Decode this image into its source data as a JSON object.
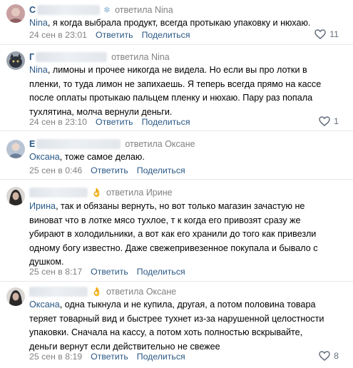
{
  "comments": [
    {
      "author_initial": "С",
      "badge": "❄",
      "replied_to": "ответила Nina",
      "mention": "Nina",
      "lines": [
        ", я когда выбрала продукт, всегда протыкаю упаковку и нюхаю."
      ],
      "time": "24 сен в 23:01",
      "reply_label": "Ответить",
      "share_label": "Поделиться",
      "likes": "11",
      "avatar_color": "#b98b8c"
    },
    {
      "author_initial": "Г",
      "replied_to": "ответила Nina",
      "mention": "Nina",
      "lines": [
        ", лимоны и прочее никогда не видела. Но если вы про лотки в",
        "пленки, то туда лимон не запихаешь. Я теперь всегда прямо на кассе",
        "после оплаты протыкаю пальцем пленку и нюхаю. Пару раз попала",
        "тухлятина, молча вернули деньги."
      ],
      "time": "24 сен в 23:10",
      "reply_label": "Ответить",
      "share_label": "Поделиться",
      "likes": "1",
      "avatar_color": "#3c4350"
    },
    {
      "author_initial": "Е",
      "replied_to": "ответила Оксане",
      "mention": "Оксана",
      "lines": [
        ", тоже самое делаю."
      ],
      "time": "25 сен в 0:46",
      "reply_label": "Ответить",
      "share_label": "Поделиться",
      "avatar_color": "#8a9bb2"
    },
    {
      "badge": "👌",
      "replied_to": "ответила Ирине",
      "mention": "Ирина",
      "lines": [
        ", так и обязаны вернуть, но вот только магазин зачастую не",
        "виноват что в лотке мясо тухлое, т к когда его привозят сразу же",
        "убирают в холодильники, а вот как его хранили до того как привезли",
        "одному богу известно. Даже свежепривезенное покупала и бывало с",
        "душком."
      ],
      "time": "25 сен в 8:17",
      "reply_label": "Ответить",
      "share_label": "Поделиться",
      "avatar_color": "#2d2b2b"
    },
    {
      "badge": "👌",
      "replied_to": "ответила Оксане",
      "mention": "Оксана",
      "lines": [
        ", одна тыкнула и не купила, другая, а потом половина товара",
        "теряет товарный вид и быстрее тухнет из-за нарушенной целостности",
        "упаковки. Сначала на кассу, а потом хоть полностью вскрывайте,",
        "деньги вернут если действительно не свежее"
      ],
      "time": "25 сен в 8:19",
      "reply_label": "Ответить",
      "share_label": "Поделиться",
      "likes": "8",
      "avatar_color": "#2d2b2b"
    }
  ],
  "icons": {
    "like": "heart-outline-icon",
    "like_color": "#626d7a",
    "link_color": "#2a5885",
    "meta_color": "#828282"
  }
}
